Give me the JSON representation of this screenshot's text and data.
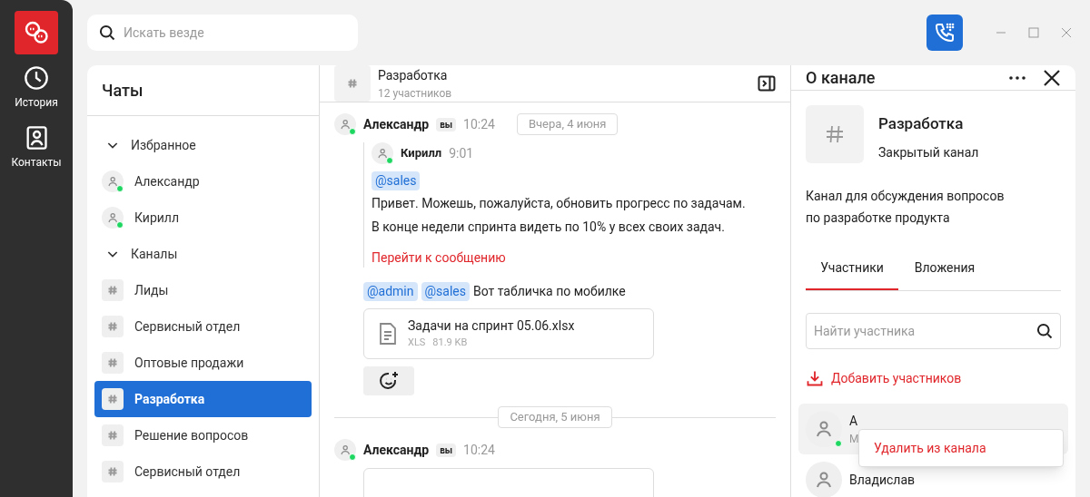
{
  "rail": {
    "items": [
      {
        "label": "История",
        "kind": "history"
      },
      {
        "label": "Контакты",
        "kind": "contacts"
      }
    ]
  },
  "search": {
    "placeholder": "Искать везде"
  },
  "chats": {
    "title": "Чаты",
    "sections": [
      {
        "title": "Избранное",
        "expanded": true,
        "items": [
          {
            "name": "Александр",
            "kind": "person",
            "online": true,
            "selected": false
          },
          {
            "name": "Кирилл",
            "kind": "person",
            "online": true,
            "selected": false
          }
        ]
      },
      {
        "title": "Каналы",
        "expanded": true,
        "items": [
          {
            "name": "Лиды",
            "kind": "channel",
            "selected": false
          },
          {
            "name": "Сервисный отдел",
            "kind": "channel",
            "selected": false
          },
          {
            "name": "Оптовые продажи",
            "kind": "channel",
            "selected": false
          },
          {
            "name": "Разработка",
            "kind": "channel",
            "selected": true
          },
          {
            "name": "Решение вопросов",
            "kind": "channel",
            "selected": false
          },
          {
            "name": "Сервисный отдел",
            "kind": "channel",
            "selected": false
          }
        ]
      }
    ]
  },
  "conversation": {
    "title": "Разработка",
    "subtitle": "12 участников",
    "feed": [
      {
        "kind": "message",
        "author": "Александр",
        "badge": "вы",
        "time": "10:24",
        "date_chip": "Вчера, 4 июня",
        "online": true,
        "quote": {
          "author": "Кирилл",
          "time": "9:01",
          "online": true,
          "mentions": [
            "@sales"
          ],
          "lines": [
            "Привет. Можешь, пожалуйста, обновить прогресс по задачам.",
            "В конце недели спринта видеть по 10% у всех своих задач."
          ],
          "link": "Перейти к сообщению"
        },
        "mentions": [
          "@admin",
          "@sales"
        ],
        "text": "Вот табличка по мобилке",
        "file": {
          "name": "Задачи на спринт 05.06.xlsx",
          "type": "XLS",
          "size": "81.9 KB"
        },
        "reaction_button": true
      },
      {
        "kind": "divider",
        "label": "Сегодня, 5 июня"
      },
      {
        "kind": "message",
        "author": "Александр",
        "badge": "вы",
        "time": "10:24",
        "online": true,
        "attachment_cut": true
      }
    ]
  },
  "details": {
    "title": "О канале",
    "channel_name": "Разработка",
    "channel_type": "Закрытый канал",
    "description": [
      "Канал для обсуждения вопросов",
      "по разработке продукта"
    ],
    "tabs": [
      {
        "label": "Участники",
        "selected": true
      },
      {
        "label": "Вложения",
        "selected": false
      }
    ],
    "member_search": {
      "placeholder": "Найти участника"
    },
    "add_button": "Добавить участников",
    "members": [
      {
        "name": "А",
        "role": "М",
        "online": true,
        "hovered": true
      },
      {
        "name": "Владислав",
        "online": false,
        "hovered": false
      }
    ],
    "context_menu": {
      "items": [
        "Удалить из канала"
      ]
    }
  }
}
